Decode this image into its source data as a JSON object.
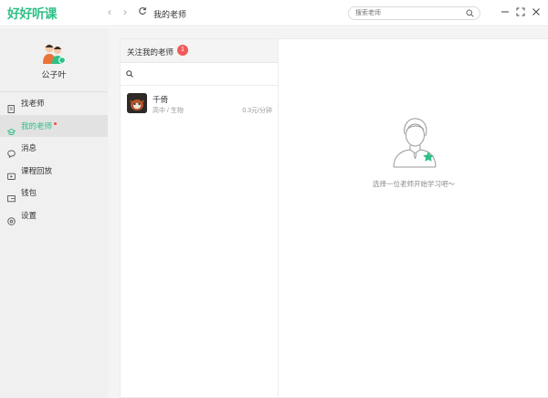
{
  "app": {
    "logo": "好好听课"
  },
  "titlebar": {
    "back_icon": "chevron-left-icon",
    "forward_icon": "chevron-right-icon",
    "refresh_icon": "refresh-icon",
    "page_title": "我的老师",
    "search": {
      "placeholder": "搜索老师",
      "icon": "search-icon"
    },
    "window_controls": [
      "minimize-icon",
      "fullscreen-icon",
      "close-icon"
    ]
  },
  "sidebar": {
    "user": {
      "name": "公子叶"
    },
    "items": [
      {
        "label": "找老师",
        "icon": "find-teacher-icon",
        "active": false
      },
      {
        "label": "我的老师",
        "icon": "graduation-cap-icon",
        "active": true,
        "has_dot": true
      },
      {
        "label": "消息",
        "icon": "chat-bubble-icon",
        "active": false
      },
      {
        "label": "课程回放",
        "icon": "video-play-icon",
        "active": false
      },
      {
        "label": "钱包",
        "icon": "wallet-icon",
        "active": false
      },
      {
        "label": "设置",
        "icon": "settings-icon",
        "active": false
      }
    ]
  },
  "teacher_list": {
    "title": "关注我的老师",
    "badge": "1",
    "search_icon": "search-icon",
    "teachers": [
      {
        "name": "千倚",
        "subject": "高中 / 生物",
        "price": "0.3元/分钟"
      }
    ]
  },
  "detail": {
    "empty_text": "选择一位老师开始学习吧～",
    "illustration_icon": "teacher-star-illustration"
  },
  "colors": {
    "accent": "#2fc087",
    "badge": "#f05a5a",
    "sidebar_bg": "#f0f0f0",
    "active_item_bg": "#e2e2e2"
  }
}
